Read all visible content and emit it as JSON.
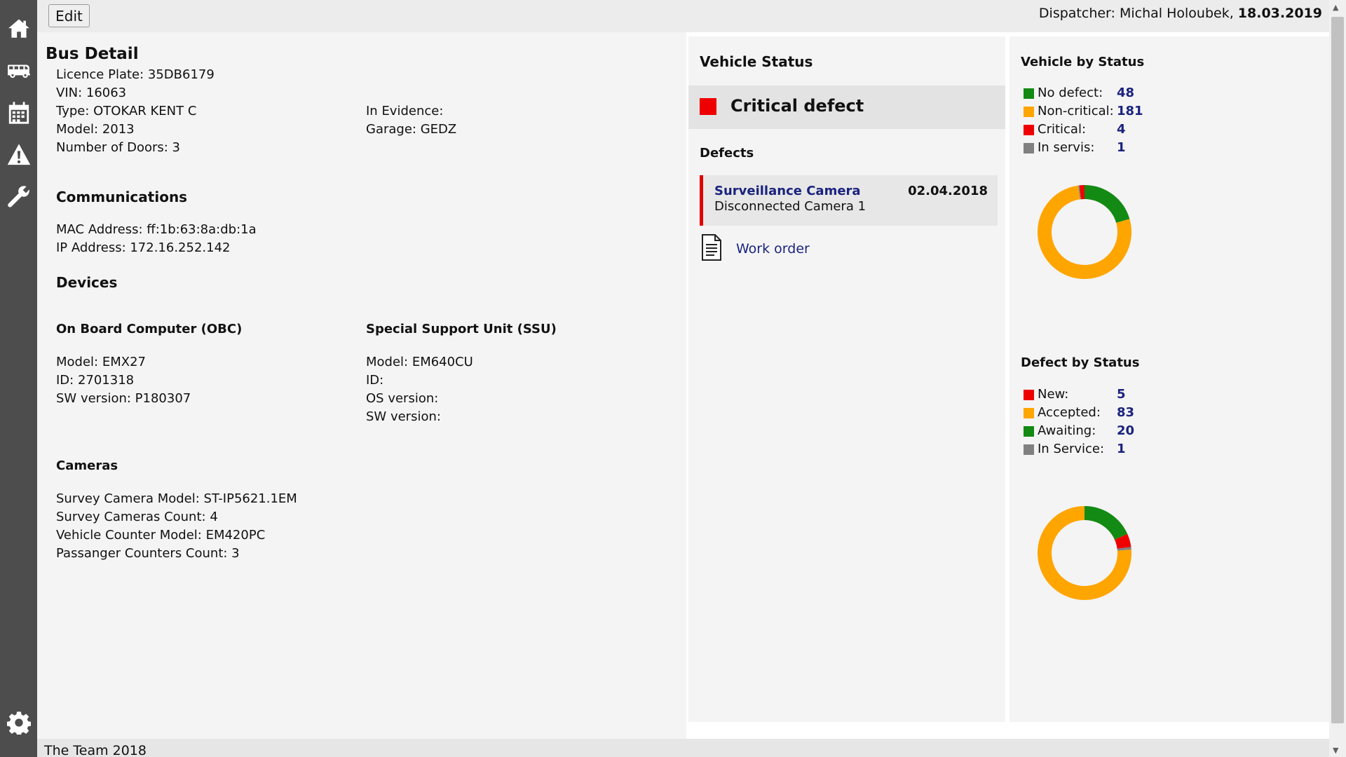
{
  "header": {
    "edit_label": "Edit",
    "dispatcher_prefix": "Dispatcher: Michal Holoubek,",
    "date": "18.03.2019"
  },
  "nav": [
    {
      "name": "home-icon"
    },
    {
      "name": "bus-icon"
    },
    {
      "name": "calendar-icon"
    },
    {
      "name": "warning-icon"
    },
    {
      "name": "wrench-icon"
    },
    {
      "name": "gear-icon"
    }
  ],
  "bus": {
    "title": "Bus Detail",
    "licence_plate": "Licence Plate: 35DB6179",
    "vin": "VIN: 16063",
    "type": "Type: OTOKAR KENT C",
    "model": "Model: 2013",
    "doors": "Number of Doors: 3",
    "in_evidence": "In Evidence:",
    "garage": "Garage: GEDZ"
  },
  "communications": {
    "title": "Communications",
    "mac": "MAC Address: ff:1b:63:8a:db:1a",
    "ip": "IP Address: 172.16.252.142"
  },
  "devices": {
    "title": "Devices",
    "obc": {
      "title": "On Board Computer (OBC)",
      "model": "Model: EMX27",
      "id": "ID: 2701318",
      "sw": "SW version: P180307"
    },
    "ssu": {
      "title": "Special Support Unit (SSU)",
      "model": "Model: EM640CU",
      "id": "ID:",
      "os": "OS version:",
      "sw": "SW version:"
    }
  },
  "cameras": {
    "title": "Cameras",
    "survey_model": "Survey Camera Model: ST-IP5621.1EM",
    "survey_count": "Survey Cameras Count: 4",
    "counter_model": "Vehicle Counter Model: EM420PC",
    "passenger_count": "Passanger Counters Count: 3"
  },
  "vehicle_status": {
    "title": "Vehicle Status",
    "status": "Critical defect",
    "status_color": "#ee0000",
    "defects_title": "Defects",
    "defect": {
      "title": "Surveillance Camera",
      "description": "Disconnected Camera 1",
      "date": "02.04.2018"
    },
    "work_order": "Work order"
  },
  "vehicle_by_status": {
    "title": "Vehicle by Status",
    "items": [
      {
        "label": "No defect:",
        "value": "48",
        "color": "#138a13"
      },
      {
        "label": "Non-critical:",
        "value": "181",
        "color": "#ffa500"
      },
      {
        "label": "Critical:",
        "value": "4",
        "color": "#ee0000"
      },
      {
        "label": "In servis:",
        "value": "1",
        "color": "#808080"
      }
    ]
  },
  "defect_by_status": {
    "title": "Defect by Status",
    "items": [
      {
        "label": "New:",
        "value": "5",
        "color": "#ee0000"
      },
      {
        "label": "Accepted:",
        "value": "83",
        "color": "#ffa500"
      },
      {
        "label": "Awaiting:",
        "value": "20",
        "color": "#138a13"
      },
      {
        "label": "In Service:",
        "value": "1",
        "color": "#808080"
      }
    ]
  },
  "footer": {
    "text": "The Team 2018"
  }
}
